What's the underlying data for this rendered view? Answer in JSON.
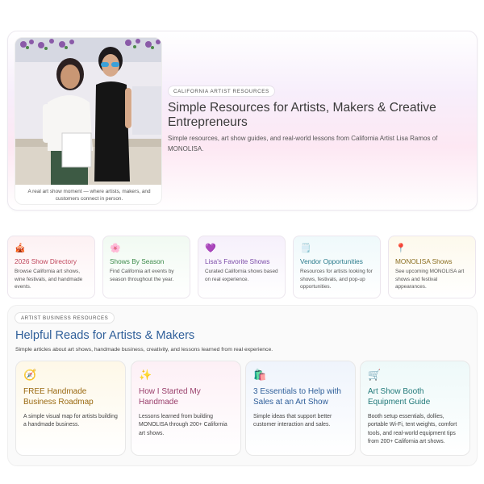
{
  "hero": {
    "eyebrow": "CALIFORNIA ARTIST RESOURCES",
    "title": "Simple Resources for Artists, Makers & Creative Entrepreneurs",
    "subtitle": "Simple resources, art show guides, and real-world lessons from California Artist Lisa Ramos of MONOLISA.",
    "photo_caption": "A real art show moment — where artists, makers, and customers connect in person."
  },
  "categories": [
    {
      "icon": "🎪",
      "icon_name": "circus-tent-icon",
      "title": "2026 Show Directory",
      "desc": "Browse California art shows, wine festivals, and handmade events.",
      "color": "#c0475c",
      "bg": "#fdf1f3"
    },
    {
      "icon": "🌸",
      "icon_name": "flower-icon",
      "title": "Shows By Season",
      "desc": "Find California art events by season throughout the year.",
      "color": "#3c8a4a",
      "bg": "#f1faf2"
    },
    {
      "icon": "💜",
      "icon_name": "heart-icon",
      "title": "Lisa's Favorite Shows",
      "desc": "Curated California shows based on real experience.",
      "color": "#7a4aa8",
      "bg": "#f6f0fb"
    },
    {
      "icon": "🗒️",
      "icon_name": "notepad-icon",
      "title": "Vendor Opportunities",
      "desc": "Resources for artists looking for shows, festivals, and pop-up opportunities.",
      "color": "#2a7b8c",
      "bg": "#eff9fb"
    },
    {
      "icon": "📍",
      "icon_name": "pin-icon",
      "title": "MONOLISA Shows",
      "desc": "See upcoming MONOLISA art shows and festival appearances.",
      "color": "#8a6d1f",
      "bg": "#fdf9ec"
    }
  ],
  "reads": {
    "eyebrow": "ARTIST BUSINESS RESOURCES",
    "title": "Helpful Reads for Artists & Makers",
    "subtitle": "Simple articles about art shows, handmade business, creativity, and lessons learned from real experience.",
    "cards": [
      {
        "icon": "🧭",
        "icon_name": "compass-icon",
        "title": "FREE Handmade Business Roadmap",
        "desc": "A simple visual map for artists building a handmade business.",
        "color": "#9a6a12",
        "bg": "#fef8e8"
      },
      {
        "icon": "✨",
        "icon_name": "sparkles-icon",
        "title": "How I Started My Handmade",
        "desc": "Lessons learned from building MONOLISA through 200+ California art shows.",
        "color": "#9a3f6b",
        "bg": "#fdf0f6"
      },
      {
        "icon": "🛍️",
        "icon_name": "shopping-bags-icon",
        "title": "3 Essentials to Help with Sales at an Art Show",
        "desc": "Simple ideas that support better customer interaction and sales.",
        "color": "#2f5f9a",
        "bg": "#eff4fc"
      },
      {
        "icon": "🛒",
        "icon_name": "shopping-cart-icon",
        "title": "Art Show Booth Equipment Guide",
        "desc": "Booth setup essentials, dollies, portable Wi-Fi, tent weights, comfort tools, and real-world equipment tips from 200+ California art shows.",
        "color": "#227a7a",
        "bg": "#eef9f9"
      }
    ]
  }
}
